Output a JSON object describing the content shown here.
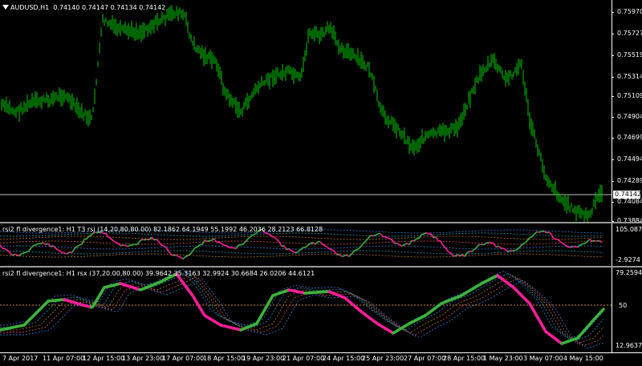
{
  "main": {
    "symbol": "AUDUSD,H1",
    "ohlc": "0.74140 0.74147 0.74134 0.74142",
    "collapse_icon": "triangle-down-icon",
    "price_scale": [
      "0.75970",
      "0.75727",
      "0.75519",
      "0.75314",
      "0.75109",
      "0.74904",
      "0.74699",
      "0.74494",
      "0.74289",
      "0.74084",
      "0.73884"
    ],
    "current_price": "0.74142",
    "candle_color": "#00c800"
  },
  "ind1": {
    "title": "rsi2 fl divergence1: H1 T3 rsi (14,20,80,80.00) 82.1862 64.1949 55.1992 46.2036 28.2123 66.8128",
    "scale_top": "105.0873",
    "scale_bottom": "-2.9274"
  },
  "ind2": {
    "title": "rsi2 fl divergence1: H1 rsx (37,20.00,80.00) 39.9642 35.3163 32.9924 30.6684 26.0206 44.6121",
    "scale_top": "79.2594",
    "scale_mid": "50",
    "scale_bottom": "12.9637",
    "up_color": "#3cb43c",
    "down_color": "#ff1e9b"
  },
  "time_axis": [
    "7 Apr 2017",
    "11 Apr 07:00",
    "12 Apr 15:00",
    "13 Apr 23:00",
    "17 Apr 07:00",
    "18 Apr 15:00",
    "19 Apr 23:00",
    "21 Apr 07:00",
    "24 Apr 15:00",
    "25 Apr 23:00",
    "27 Apr 07:00",
    "28 Apr 15:00",
    "1 May 23:00",
    "3 May 07:00",
    "4 May 15:00"
  ]
}
